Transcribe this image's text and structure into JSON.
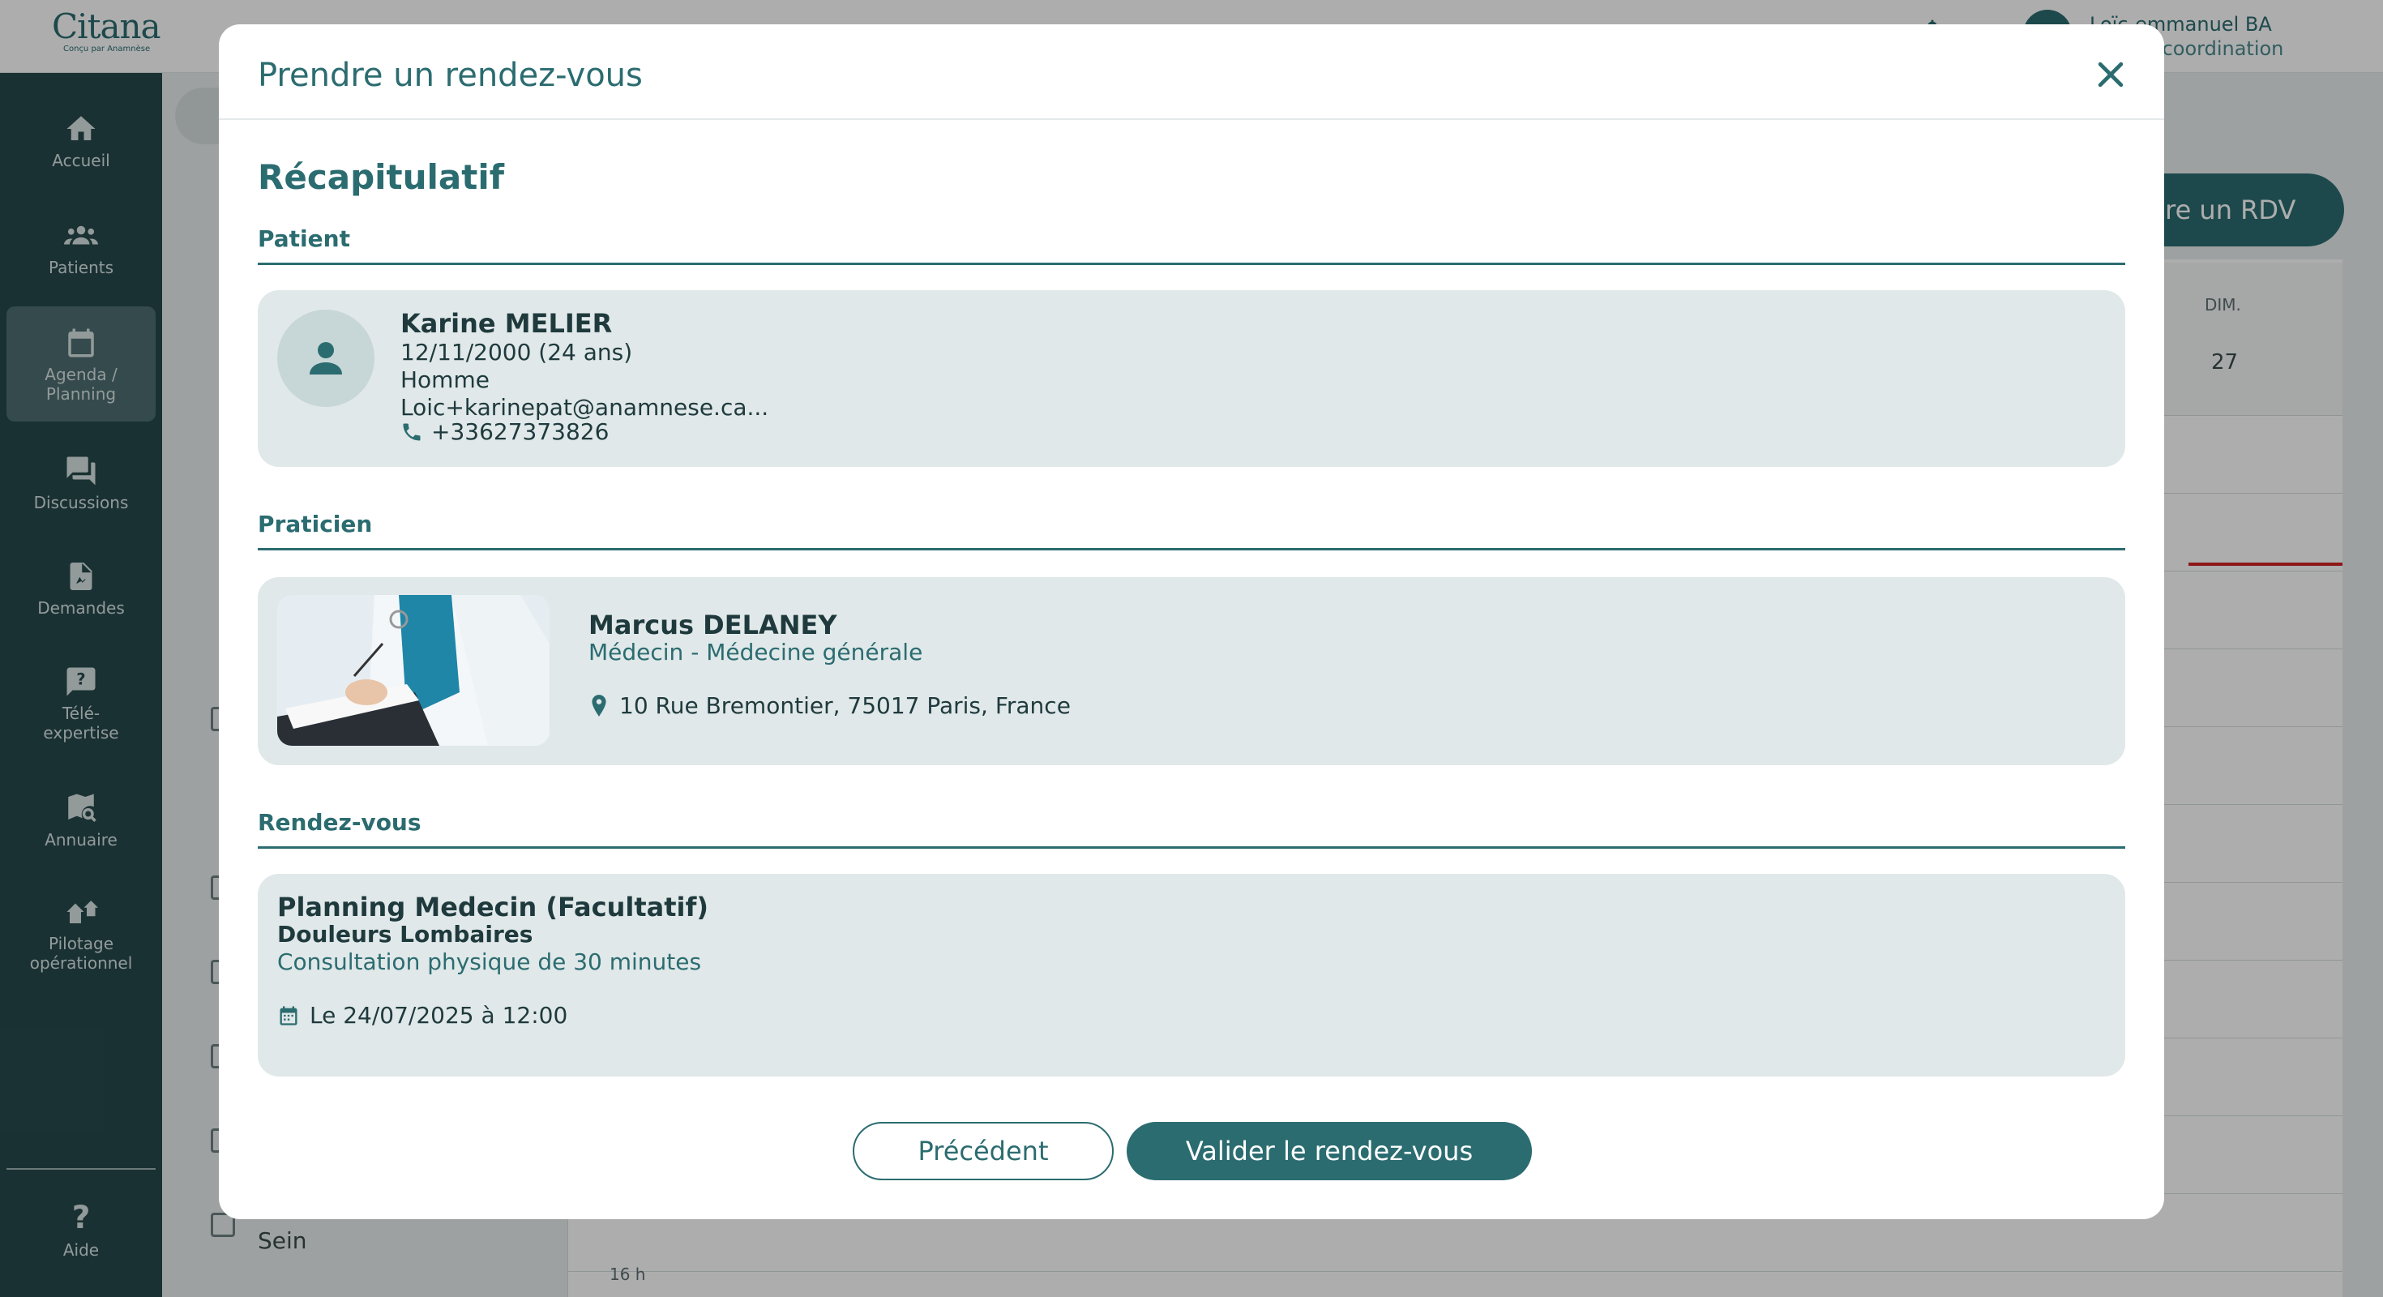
{
  "app": {
    "logo_name": "Citana",
    "logo_sub": "Conçu par Anamnèse",
    "user_name": "Loïc-emmanuel BA",
    "user_role": "...el de coordination",
    "rdv_button": "...ndre un RDV"
  },
  "sidebar": {
    "items": [
      {
        "label": "Accueil",
        "icon": "home-icon"
      },
      {
        "label": "Patients",
        "icon": "patients-icon"
      },
      {
        "label": "Agenda / Planning",
        "icon": "calendar-icon",
        "active": true
      },
      {
        "label": "Discussions",
        "icon": "chat-icon"
      },
      {
        "label": "Demandes",
        "icon": "document-icon"
      },
      {
        "label": "Télé-expertise",
        "icon": "help-bubble-icon"
      },
      {
        "label": "Annuaire",
        "icon": "map-search-icon"
      },
      {
        "label": "Pilotage opérationnel",
        "icon": "pilotage-icon"
      }
    ],
    "help": {
      "label": "Aide",
      "icon": "question-icon"
    }
  },
  "calendar": {
    "day_label": "DIM.",
    "day_number": "27",
    "hour_label": "16 h",
    "list_item": "Sein"
  },
  "modal": {
    "title": "Prendre un rendez-vous",
    "recap_title": "Récapitulatif",
    "sections": {
      "patient": "Patient",
      "praticien": "Praticien",
      "rendez_vous": "Rendez-vous"
    },
    "patient": {
      "name": "Karine MELIER",
      "birth": "12/11/2000 (24 ans)",
      "gender": "Homme",
      "email": "Loic+karinepat@anamnese.ca...",
      "phone": "+33627373826"
    },
    "praticien": {
      "name": "Marcus DELANEY",
      "specialty": "Médecin - Médecine générale",
      "address": "10 Rue Bremontier, 75017 Paris, France"
    },
    "rendez_vous": {
      "planning": "Planning Medecin (Facultatif)",
      "motif": "Douleurs Lombaires",
      "description": "Consultation physique de 30 minutes",
      "date": "Le 24/07/2025 à 12:00"
    },
    "buttons": {
      "previous": "Précédent",
      "validate": "Valider le rendez-vous"
    }
  },
  "colors": {
    "accent": "#2b6c70",
    "sidebar": "#27494c",
    "card": "#e0e8e9"
  }
}
